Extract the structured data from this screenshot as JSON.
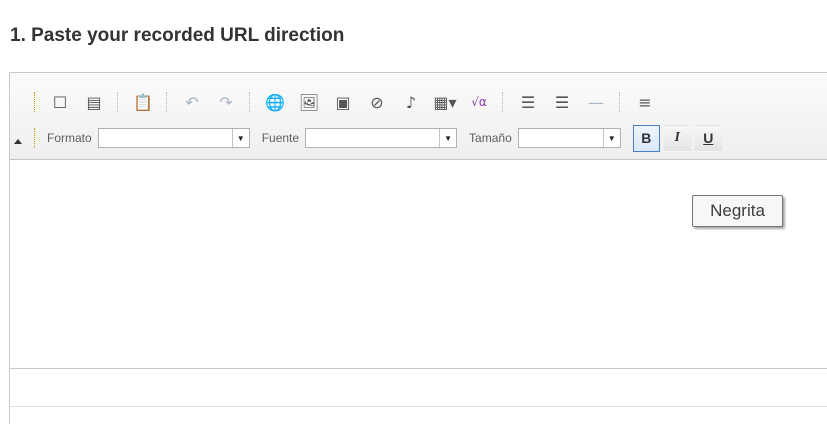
{
  "heading": "1. Paste your recorded URL direction",
  "toolbar": {
    "row1": [
      {
        "name": "new-page-icon",
        "glyph": "☐"
      },
      {
        "name": "templates-icon",
        "glyph": "▤"
      },
      {
        "name": "paste-word-icon",
        "glyph": "📋"
      },
      {
        "name": "undo-icon",
        "glyph": "↶"
      },
      {
        "name": "redo-icon",
        "glyph": "↷"
      },
      {
        "name": "link-icon",
        "glyph": "🌐"
      },
      {
        "name": "image-icon",
        "glyph": "🖼"
      },
      {
        "name": "video-icon",
        "glyph": "▣"
      },
      {
        "name": "flash-icon",
        "glyph": "⊘"
      },
      {
        "name": "audio-icon",
        "glyph": "♪"
      },
      {
        "name": "table-icon",
        "glyph": "▦▾"
      },
      {
        "name": "equation-icon",
        "glyph": "√α"
      },
      {
        "name": "bulleted-list-icon",
        "glyph": "☰"
      },
      {
        "name": "numbered-list-icon",
        "glyph": "☰"
      },
      {
        "name": "horizontal-rule-icon",
        "glyph": "—"
      },
      {
        "name": "align-left-icon",
        "glyph": "≡"
      }
    ],
    "format_label": "Formato",
    "font_label": "Fuente",
    "size_label": "Tamaño",
    "bold_label": "B",
    "italic_label": "I",
    "underline_label": "U"
  },
  "tooltip": "Negrita",
  "colors": {
    "accent": "#4a7fc1",
    "heading": "#333333",
    "border": "#c9c9c9"
  }
}
